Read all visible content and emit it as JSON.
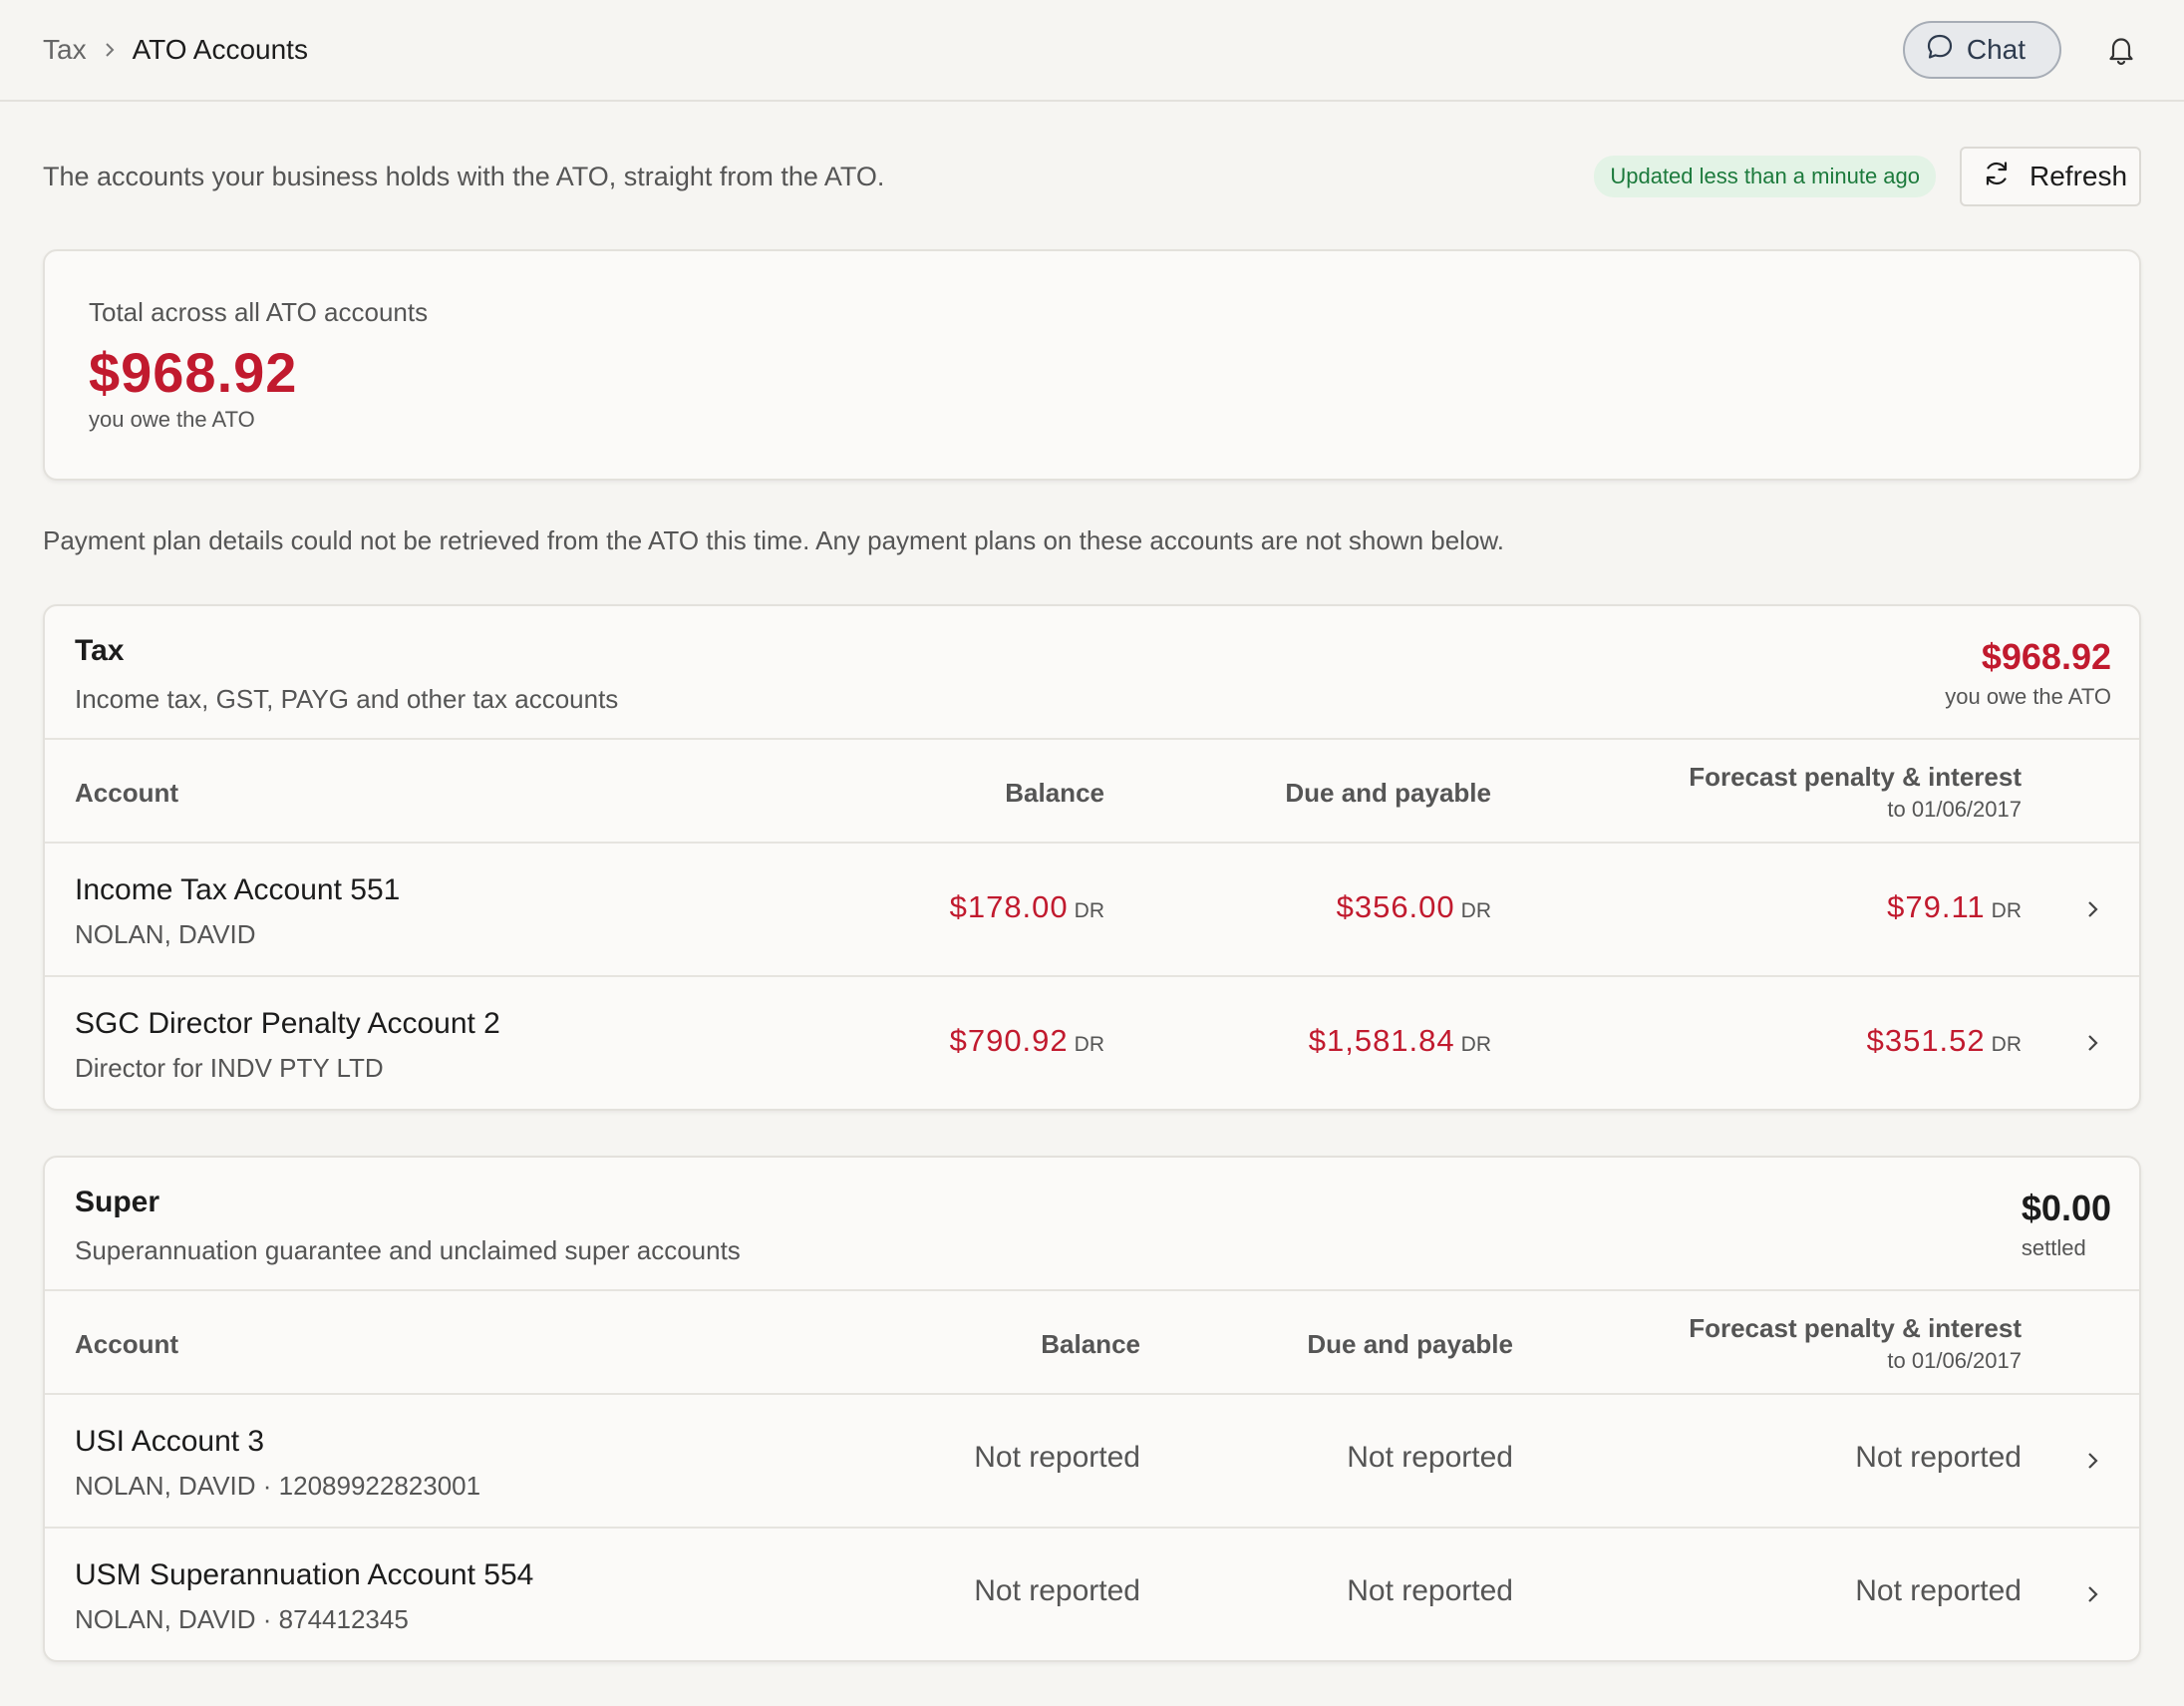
{
  "breadcrumb": {
    "parent": "Tax",
    "current": "ATO Accounts"
  },
  "header": {
    "chat_label": "Chat"
  },
  "intro": {
    "text": "The accounts your business holds with the ATO, straight from the ATO.",
    "updated": "Updated less than a minute ago",
    "refresh_label": "Refresh"
  },
  "total": {
    "label": "Total across all ATO accounts",
    "amount": "$968.92",
    "sub": "you owe the ATO"
  },
  "notice": "Payment plan details could not be retrieved from the ATO this time. Any payment plans on these accounts are not shown below.",
  "columns": {
    "account": "Account",
    "balance": "Balance",
    "due": "Due and payable",
    "forecast": "Forecast penalty & interest",
    "forecast_date": "to 01/06/2017"
  },
  "tax": {
    "title": "Tax",
    "description": "Income tax, GST, PAYG and other tax accounts",
    "total": "$968.92",
    "total_sub": "you owe the ATO",
    "rows": [
      {
        "name": "Income Tax Account 551",
        "sub": "NOLAN, DAVID",
        "balance": "$178.00",
        "due": "$356.00",
        "forecast": "$79.11",
        "suffix": "DR"
      },
      {
        "name": "SGC Director Penalty Account 2",
        "sub": "Director for INDV PTY LTD",
        "balance": "$790.92",
        "due": "$1,581.84",
        "forecast": "$351.52",
        "suffix": "DR"
      }
    ]
  },
  "super": {
    "title": "Super",
    "description": "Superannuation guarantee and unclaimed super accounts",
    "total": "$0.00",
    "total_sub": "settled",
    "rows": [
      {
        "name": "USI Account 3",
        "sub": "NOLAN, DAVID · 12089922823001",
        "balance": "Not reported",
        "due": "Not reported",
        "forecast": "Not reported"
      },
      {
        "name": "USM Superannuation Account 554",
        "sub": "NOLAN, DAVID · 874412345",
        "balance": "Not reported",
        "due": "Not reported",
        "forecast": "Not reported"
      }
    ]
  },
  "colors": {
    "owe": "#c11a2e",
    "updated_bg": "#e3f3e6",
    "updated_text": "#1c7a3c"
  },
  "icons": [
    "chevron-right-icon",
    "chat-bubble-icon",
    "bell-icon",
    "refresh-icon"
  ]
}
